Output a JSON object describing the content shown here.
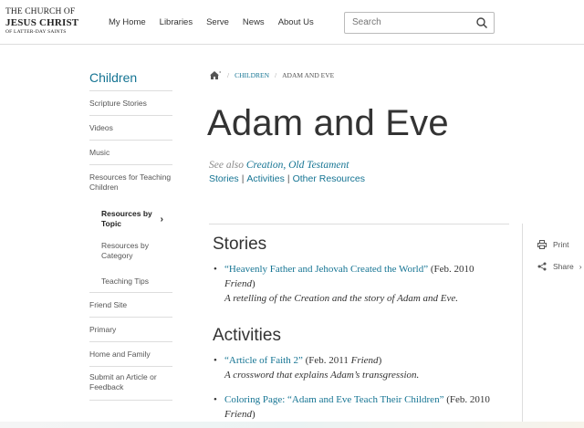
{
  "header": {
    "logo": {
      "line1": "THE CHURCH OF",
      "line2": "JESUS CHRIST",
      "line3": "OF LATTER-DAY SAINTS"
    },
    "nav": [
      "My Home",
      "Libraries",
      "Serve",
      "News",
      "About Us"
    ],
    "search": {
      "placeholder": "Search",
      "icon": "search-icon"
    }
  },
  "sidebar": {
    "title": "Children",
    "items": [
      {
        "label": "Scripture Stories"
      },
      {
        "label": "Videos"
      },
      {
        "label": "Music"
      },
      {
        "label": "Resources for Teaching Children"
      },
      {
        "label": "Resources by Topic",
        "sub": true,
        "active": true
      },
      {
        "label": "Resources by Category",
        "sub": true
      },
      {
        "label": "Teaching Tips",
        "sub": true
      },
      {
        "label": "Friend Site"
      },
      {
        "label": "Primary"
      },
      {
        "label": "Home and Family"
      },
      {
        "label": "Submit an Article or Feedback"
      }
    ]
  },
  "breadcrumb": {
    "home_icon": "home-icon",
    "items": [
      "CHILDREN",
      "ADAM AND EVE"
    ]
  },
  "page": {
    "title": "Adam and Eve",
    "see_also_prefix": "See also",
    "see_also_links": [
      "Creation",
      "Old Testament"
    ],
    "section_links": [
      "Stories",
      "Activities",
      "Other Resources"
    ]
  },
  "tools": {
    "print": "Print",
    "share": "Share"
  },
  "sections": {
    "stories": {
      "heading": "Stories",
      "entries": [
        {
          "link": "“Heavenly Father and Jehovah Created the World”",
          "date": "(Feb. 2010",
          "publication": "Friend",
          "description": "A retelling of the Creation and the story of Adam and Eve."
        }
      ]
    },
    "activities": {
      "heading": "Activities",
      "entries": [
        {
          "link": "“Article of Faith 2”",
          "date": "(Feb. 2011",
          "publication": "Friend",
          "description": "A crossword that explains Adam’s transgression."
        },
        {
          "link": "Coloring Page: “Adam and Eve Teach Their Children”",
          "date": "(Feb. 2010",
          "publication": "Friend"
        }
      ]
    }
  },
  "colors": {
    "link": "#157493",
    "text": "#333333",
    "border": "#dddddd"
  }
}
